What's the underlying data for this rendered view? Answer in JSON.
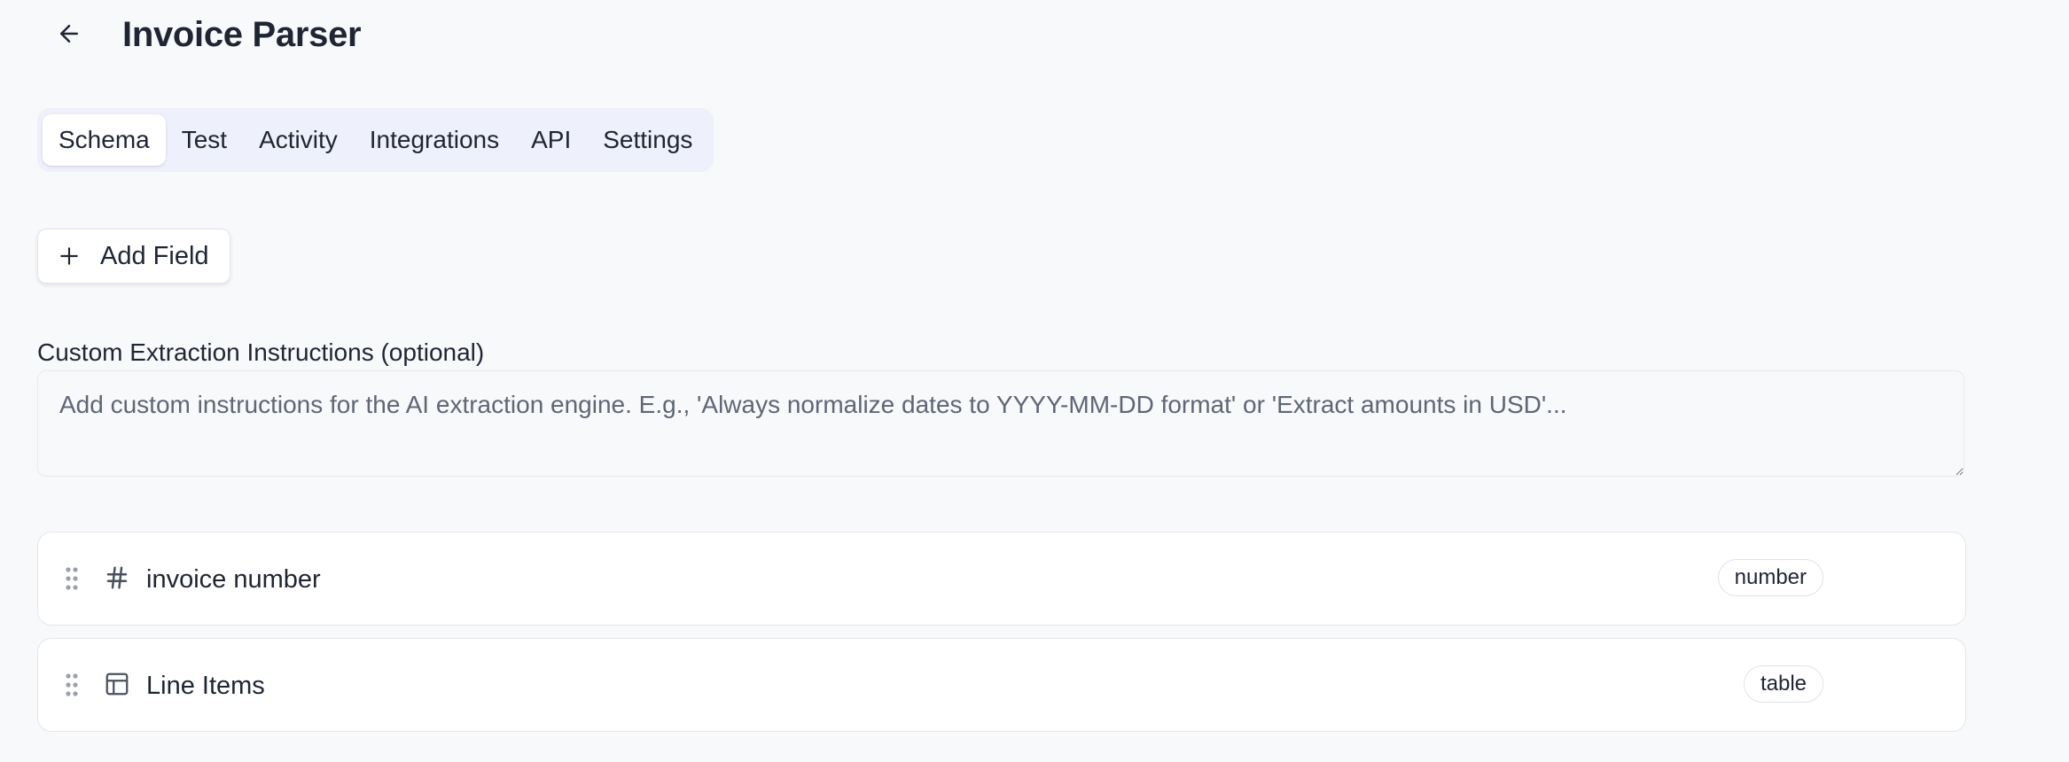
{
  "header": {
    "title": "Invoice Parser",
    "back_icon": "arrow-left-icon"
  },
  "tabs": [
    {
      "label": "Schema",
      "active": true
    },
    {
      "label": "Test",
      "active": false
    },
    {
      "label": "Activity",
      "active": false
    },
    {
      "label": "Integrations",
      "active": false
    },
    {
      "label": "API",
      "active": false
    },
    {
      "label": "Settings",
      "active": false
    }
  ],
  "toolbar": {
    "add_field_label": "Add Field",
    "add_field_icon": "plus-icon"
  },
  "instructions": {
    "label": "Custom Extraction Instructions (optional)",
    "value": "",
    "placeholder": "Add custom instructions for the AI extraction engine. E.g., 'Always normalize dates to YYYY-MM-DD format' or 'Extract amounts in USD'..."
  },
  "fields": [
    {
      "name": "invoice number",
      "type": "number",
      "icon": "hash-icon"
    },
    {
      "name": "Line Items",
      "type": "table",
      "icon": "table-icon"
    }
  ],
  "colors": {
    "background": "#f8f9fb",
    "tab_bar": "#eef0fb",
    "text": "#1f2533",
    "muted_text": "#5f6675"
  }
}
